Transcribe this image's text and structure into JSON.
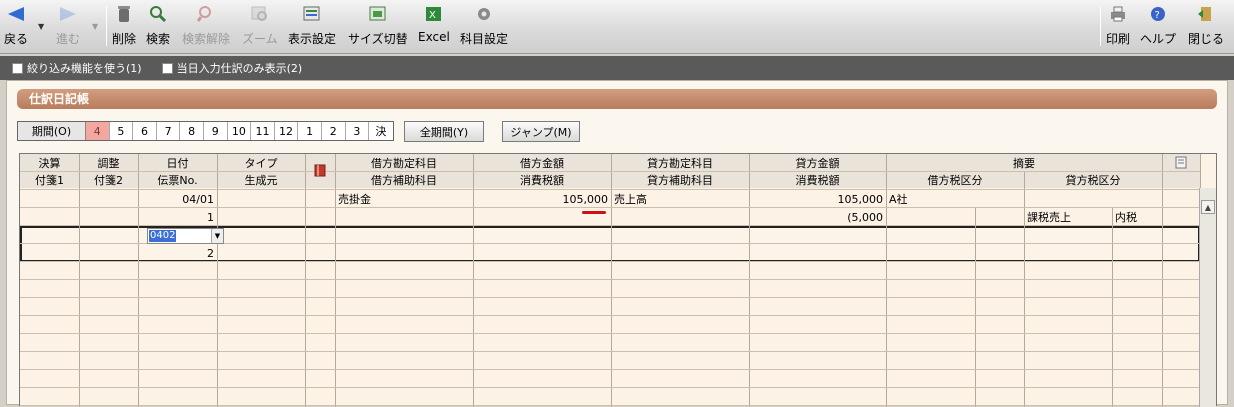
{
  "toolbar": {
    "back": "戻る",
    "forward": "進む",
    "delete": "削除",
    "search": "検索",
    "search_clear": "検索解除",
    "zoom": "ズーム",
    "display_settings": "表示設定",
    "size_toggle": "サイズ切替",
    "excel": "Excel",
    "account_settings": "科目設定",
    "print": "印刷",
    "help": "ヘルプ",
    "close": "閉じる"
  },
  "options": {
    "filter": "絞り込み機能を使う(1)",
    "today_only": "当日入力仕訳のみ表示(2)"
  },
  "panel_title": "仕訳日記帳",
  "period": {
    "label": "期間(O)",
    "months": [
      "4",
      "5",
      "6",
      "7",
      "8",
      "9",
      "10",
      "11",
      "12",
      "1",
      "2",
      "3",
      "決"
    ],
    "selected": "4",
    "all_label": "全期間(Y)",
    "jump_label": "ジャンプ(M)"
  },
  "columns_top": [
    "決算",
    "調整",
    "日付",
    "タイプ",
    "",
    "借方勘定科目",
    "借方金額",
    "貸方勘定科目",
    "貸方金額",
    "摘要"
  ],
  "columns_bottom": [
    "付箋1",
    "付箋2",
    "伝票No.",
    "生成元",
    "",
    "借方補助科目",
    "消費税額",
    "貸方補助科目",
    "消費税額",
    "借方税区分",
    "貸方税区分"
  ],
  "entries": [
    {
      "date": "04/01",
      "slip_no": "1",
      "debit_account": "売掛金",
      "debit_amount": "105,000",
      "credit_account": "売上高",
      "credit_amount": "105,000",
      "credit_tax": "(5,000",
      "memo": "A社",
      "credit_tax_class": "課税売上",
      "credit_tax_type": "内税"
    },
    {
      "date": "0402",
      "slip_no": "2"
    }
  ]
}
